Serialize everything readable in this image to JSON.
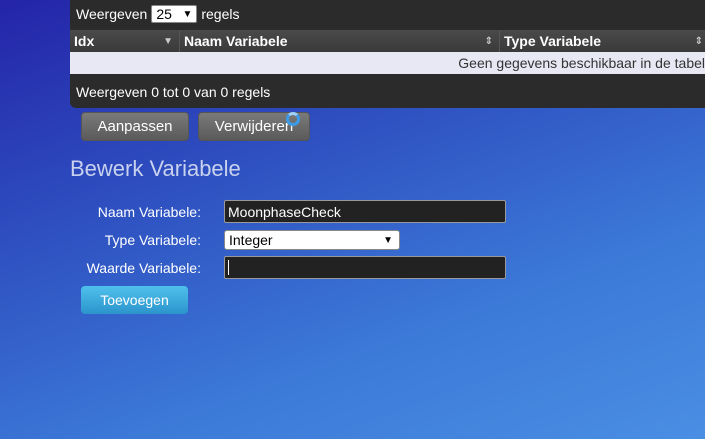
{
  "table": {
    "length_prefix": "Weergeven",
    "length_value": "25",
    "length_suffix": "regels",
    "columns": [
      "Idx",
      "Naam Variabele",
      "Type Variabele"
    ],
    "empty_message": "Geen gegevens beschikbaar in de tabel",
    "info": "Weergeven 0 tot 0 van 0 regels"
  },
  "actions": {
    "edit_label": "Aanpassen",
    "delete_label": "Verwijderen"
  },
  "form": {
    "title": "Bewerk Variabele",
    "name_label": "Naam Variabele:",
    "name_value": "MoonphaseCheck",
    "type_label": "Type Variabele:",
    "type_value": "Integer",
    "value_label": "Waarde Variabele:",
    "value_value": "",
    "submit_label": "Toevoegen"
  },
  "colors": {
    "submit_button": "#3aa9dc",
    "header_bg": "#2b2b2b"
  }
}
